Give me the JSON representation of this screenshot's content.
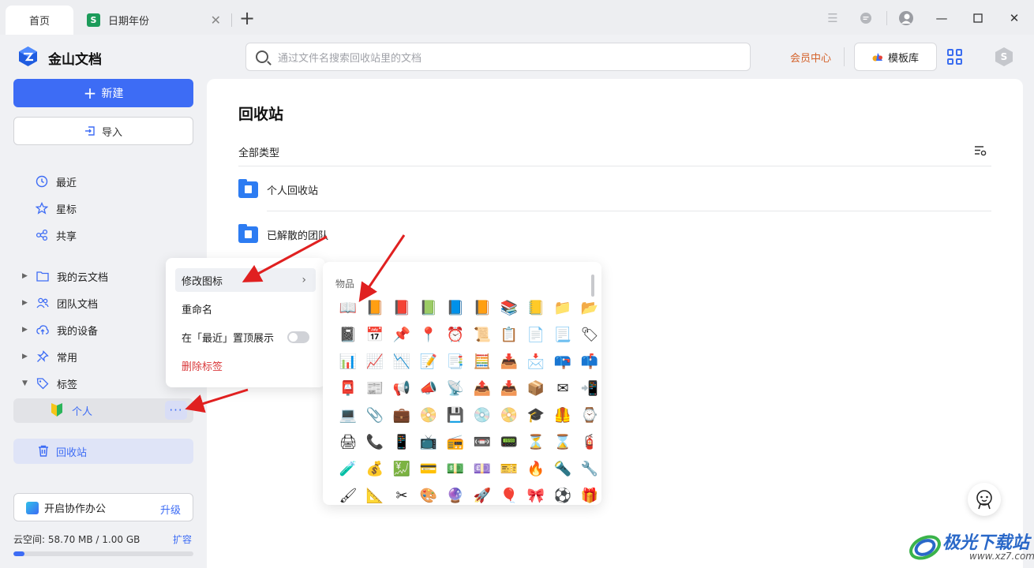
{
  "tabs": {
    "home": "首页",
    "doc_title": "日期年份",
    "doc_icon_letter": "S"
  },
  "header": {
    "brand": "金山文档",
    "search_placeholder": "通过文件名搜索回收站里的文档",
    "vip": "会员中心",
    "template_btn": "模板库",
    "hex_letter": "S"
  },
  "sidebar": {
    "new_btn": "新建",
    "import_btn": "导入",
    "nav": [
      "最近",
      "星标",
      "共享"
    ],
    "tree": [
      "我的云文档",
      "团队文档",
      "我的设备",
      "常用",
      "标签"
    ],
    "tag_child": "个人",
    "more": "···",
    "trash": "回收站",
    "collab": "开启协作办公",
    "upgrade": "升级",
    "space": "云空间: 58.70 MB / 1.00 GB",
    "expand": "扩容",
    "storage_used_fraction": 0.0573
  },
  "main": {
    "title": "回收站",
    "filter": "全部类型",
    "rows": [
      "个人回收站",
      "已解散的团队"
    ]
  },
  "context_menu": {
    "items": [
      "修改图标",
      "重命名",
      "在「最近」置顶展示",
      "删除标签"
    ],
    "danger_color": "#d9383a"
  },
  "icon_picker": {
    "category": "物品",
    "icons": [
      "📖",
      "📙",
      "📕",
      "📗",
      "📘",
      "📙",
      "📚",
      "📒",
      "📁",
      "📂",
      "📓",
      "📅",
      "📌",
      "📍",
      "⏰",
      "📜",
      "📋",
      "📄",
      "📃",
      "🏷",
      "📊",
      "📈",
      "📉",
      "📝",
      "📑",
      "🧮",
      "📥",
      "📩",
      "📪",
      "📫",
      "📮",
      "📰",
      "📢",
      "📣",
      "📡",
      "📤",
      "📥",
      "📦",
      "✉",
      "📲",
      "💻",
      "📎",
      "💼",
      "📀",
      "💾",
      "💿",
      "📀",
      "🎓",
      "🦺",
      "⌚",
      "🖨",
      "📞",
      "📱",
      "📺",
      "📻",
      "📼",
      "📟",
      "⏳",
      "⌛",
      "🧯",
      "🧪",
      "💰",
      "💹",
      "💳",
      "💵",
      "💷",
      "🎫",
      "🔥",
      "🔦",
      "🔧",
      "🖌",
      "📐",
      "✂",
      "🎨",
      "🔮",
      "🚀",
      "🎈",
      "🎀",
      "⚽",
      "🎁"
    ]
  },
  "colors": {
    "accent": "#3d6cf5",
    "vip": "#d4622a",
    "arrow": "#e02020"
  },
  "watermark": {
    "text": "极光下载站",
    "url": "www.xz7.com"
  }
}
